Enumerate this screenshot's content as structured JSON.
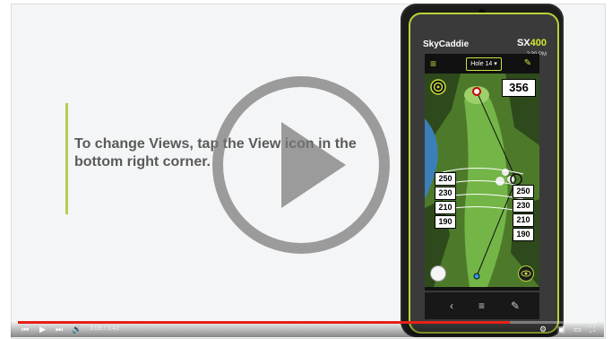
{
  "caption": "To change Views, tap the View icon in the bottom right corner.",
  "device": {
    "brand": "SkyCaddie",
    "model_prefix": "SX",
    "model_number": "400",
    "status_time": "2:30 PM",
    "hole_label": "Hole 14",
    "distance_to_green": "356",
    "yardages_left": [
      "250",
      "230",
      "210",
      "190"
    ],
    "yardages_right": [
      "250",
      "230",
      "210",
      "190"
    ],
    "nav": {
      "back": "‹",
      "menu": "≡",
      "edit": "✎"
    }
  },
  "player": {
    "time_current": "3:09",
    "time_separator": " / ",
    "time_total": "3:42",
    "progress_fraction": 0.85,
    "icons": [
      "skip-back-icon",
      "play-icon",
      "skip-next-icon",
      "volume-icon",
      "settings-icon",
      "miniplayer-icon",
      "theater-icon",
      "fullscreen-icon"
    ]
  },
  "colors": {
    "accent": "#b6d43a",
    "progress": "#e62117",
    "caption": "#5a5a5a"
  }
}
